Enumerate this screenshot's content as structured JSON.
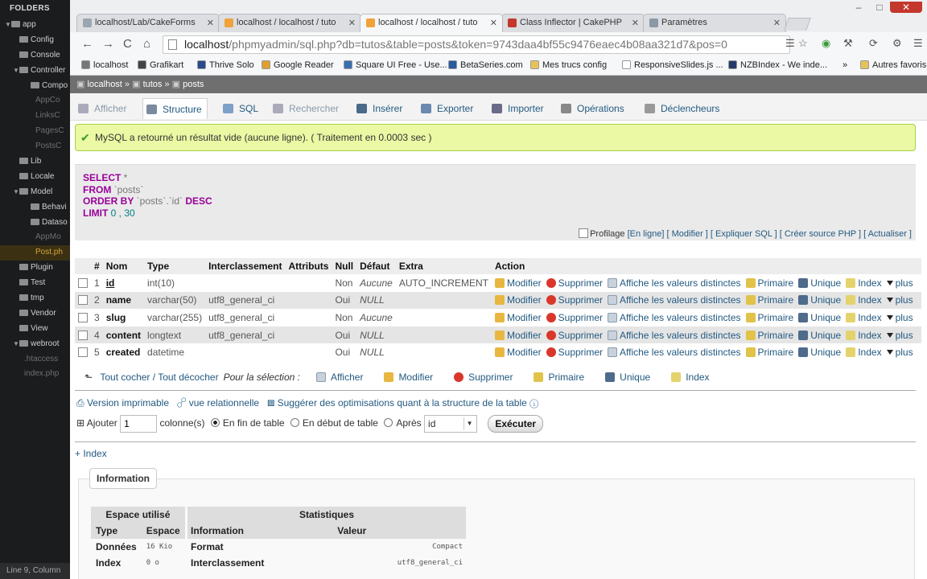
{
  "sidebar": {
    "title": "FOLDERS",
    "items": [
      {
        "label": "app",
        "type": "open"
      },
      {
        "label": "Config",
        "type": "closed"
      },
      {
        "label": "Console",
        "type": "closed"
      },
      {
        "label": "Controller",
        "type": "open"
      },
      {
        "label": "Compo",
        "type": "closed"
      },
      {
        "label": "AppCo",
        "type": "file"
      },
      {
        "label": "LinksC",
        "type": "file"
      },
      {
        "label": "PagesC",
        "type": "file"
      },
      {
        "label": "PostsC",
        "type": "file"
      },
      {
        "label": "Lib",
        "type": "closed"
      },
      {
        "label": "Locale",
        "type": "closed"
      },
      {
        "label": "Model",
        "type": "open"
      },
      {
        "label": "Behavi",
        "type": "closed"
      },
      {
        "label": "Dataso",
        "type": "closed"
      },
      {
        "label": "AppMo",
        "type": "file"
      },
      {
        "label": "Post.ph",
        "type": "selected"
      },
      {
        "label": "Plugin",
        "type": "closed"
      },
      {
        "label": "Test",
        "type": "closed"
      },
      {
        "label": "tmp",
        "type": "closed"
      },
      {
        "label": "Vendor",
        "type": "closed"
      },
      {
        "label": "View",
        "type": "closed"
      },
      {
        "label": "webroot",
        "type": "open"
      },
      {
        "label": ".htaccess",
        "type": "file"
      },
      {
        "label": "index.php",
        "type": "file"
      }
    ],
    "status": "Line 9, Column"
  },
  "browser": {
    "tabs": [
      {
        "label": "localhost/Lab/CakeForms",
        "fav": "#9aa6b2"
      },
      {
        "label": "localhost / localhost / tuto",
        "fav": "#f0a23b"
      },
      {
        "label": "localhost / localhost / tuto",
        "fav": "#f0a23b"
      },
      {
        "label": "Class Inflector | CakePHP",
        "fav": "#c4372c"
      },
      {
        "label": "Paramètres",
        "fav": "#8b98a6"
      }
    ],
    "url_host": "localhost",
    "url_rest": "/phpmyadmin/sql.php?db=tutos&table=posts&token=9743daa4bf55c9476eaec4b08aa321d7&pos=0",
    "bookmarks": [
      {
        "label": "localhost",
        "color": "#777"
      },
      {
        "label": "Grafikart",
        "color": "#444"
      },
      {
        "label": "Thrive Solo",
        "color": "#2a4a8a"
      },
      {
        "label": "Google Reader",
        "color": "#e0a030"
      },
      {
        "label": "Square UI Free - Use...",
        "color": "#3a6fb0"
      },
      {
        "label": "BetaSeries.com",
        "color": "#2a5aa0"
      },
      {
        "label": "Mes trucs config",
        "color": "#e6c25a"
      },
      {
        "label": "ResponsiveSlides.js ...",
        "color": "#fff"
      },
      {
        "label": "NZBIndex - We inde...",
        "color": "#243a6a"
      },
      {
        "label": "»",
        "color": ""
      },
      {
        "label": "Autres favoris",
        "color": "#e6c25a"
      }
    ]
  },
  "pma": {
    "breadcrumb": [
      "localhost",
      "tutos",
      "posts"
    ],
    "tabs": [
      {
        "label": "Afficher",
        "state": "dis",
        "color": "#aab"
      },
      {
        "label": "Structure",
        "state": "cur",
        "color": "#7a8aa0"
      },
      {
        "label": "SQL",
        "state": "",
        "color": "#7ea0c8"
      },
      {
        "label": "Rechercher",
        "state": "dis",
        "color": "#aab"
      },
      {
        "label": "Insérer",
        "state": "",
        "color": "#4a6a8a"
      },
      {
        "label": "Exporter",
        "state": "",
        "color": "#6a8ab0"
      },
      {
        "label": "Importer",
        "state": "",
        "color": "#6a6a8a"
      },
      {
        "label": "Opérations",
        "state": "",
        "color": "#888"
      },
      {
        "label": "Déclencheurs",
        "state": "",
        "color": "#999"
      }
    ],
    "success": "MySQL a retourné un résultat vide (aucune ligne). ( Traitement en 0.0003 sec )",
    "sql": {
      "select": "SELECT",
      "select_rest": " *",
      "from": "FROM",
      "from_rest": " `posts`",
      "orderby": "ORDER BY",
      "orderby_rest": " `posts`.`id`",
      "desc": " DESC",
      "limit": "LIMIT",
      "limit_rest": " 0 , 30"
    },
    "sql_links": {
      "profilage": "Profilage",
      "enligne": "[En ligne]",
      "modifier": "[ Modifier ]",
      "expliquer": "[ Expliquer SQL ]",
      "creer": "[ Créer source PHP ]",
      "actualiser": "[ Actualiser ]"
    },
    "table": {
      "headers": [
        "#",
        "Nom",
        "Type",
        "Interclassement",
        "Attributs",
        "Null",
        "Défaut",
        "Extra",
        "Action"
      ],
      "rows": [
        {
          "n": "1",
          "name": "id",
          "type": "int(10)",
          "coll": "",
          "attr": "",
          "null": "Non",
          "default": "Aucune",
          "extra": "AUTO_INCREMENT"
        },
        {
          "n": "2",
          "name": "name",
          "type": "varchar(50)",
          "coll": "utf8_general_ci",
          "attr": "",
          "null": "Oui",
          "default": "NULL",
          "extra": ""
        },
        {
          "n": "3",
          "name": "slug",
          "type": "varchar(255)",
          "coll": "utf8_general_ci",
          "attr": "",
          "null": "Non",
          "default": "Aucune",
          "extra": ""
        },
        {
          "n": "4",
          "name": "content",
          "type": "longtext",
          "coll": "utf8_general_ci",
          "attr": "",
          "null": "Oui",
          "default": "NULL",
          "extra": ""
        },
        {
          "n": "5",
          "name": "created",
          "type": "datetime",
          "coll": "",
          "attr": "",
          "null": "Oui",
          "default": "NULL",
          "extra": ""
        }
      ],
      "actions": [
        "Modifier",
        "Supprimer",
        "Affiche les valeurs distinctes",
        "Primaire",
        "Unique",
        "Index",
        "plus"
      ]
    },
    "selection": {
      "toggle": "Tout cocher / Tout décocher",
      "label": "Pour la sélection :",
      "actions": [
        "Afficher",
        "Modifier",
        "Supprimer",
        "Primaire",
        "Unique",
        "Index"
      ]
    },
    "links2": {
      "print": "Version imprimable",
      "relational": "vue relationnelle",
      "suggest": "Suggérer des optimisations quant à la structure de la table"
    },
    "add": {
      "label": "Ajouter",
      "count": "1",
      "columns": "colonne(s)",
      "end": "En fin de table",
      "start": "En début de table",
      "after": "Après",
      "after_value": "id",
      "button": "Exécuter"
    },
    "index_link": "+ Index",
    "info": {
      "legend": "Information",
      "space_title": "Espace utilisé",
      "space_headers": [
        "Type",
        "Espace"
      ],
      "space_rows": [
        {
          "type": "Données",
          "value": "16 Kio"
        },
        {
          "type": "Index",
          "value": "0 o"
        }
      ],
      "stats_title": "Statistiques",
      "stats_headers": [
        "Information",
        "Valeur"
      ],
      "stats_rows": [
        {
          "info": "Format",
          "value": "Compact"
        },
        {
          "info": "Interclassement",
          "value": "utf8_general_ci"
        }
      ]
    }
  }
}
